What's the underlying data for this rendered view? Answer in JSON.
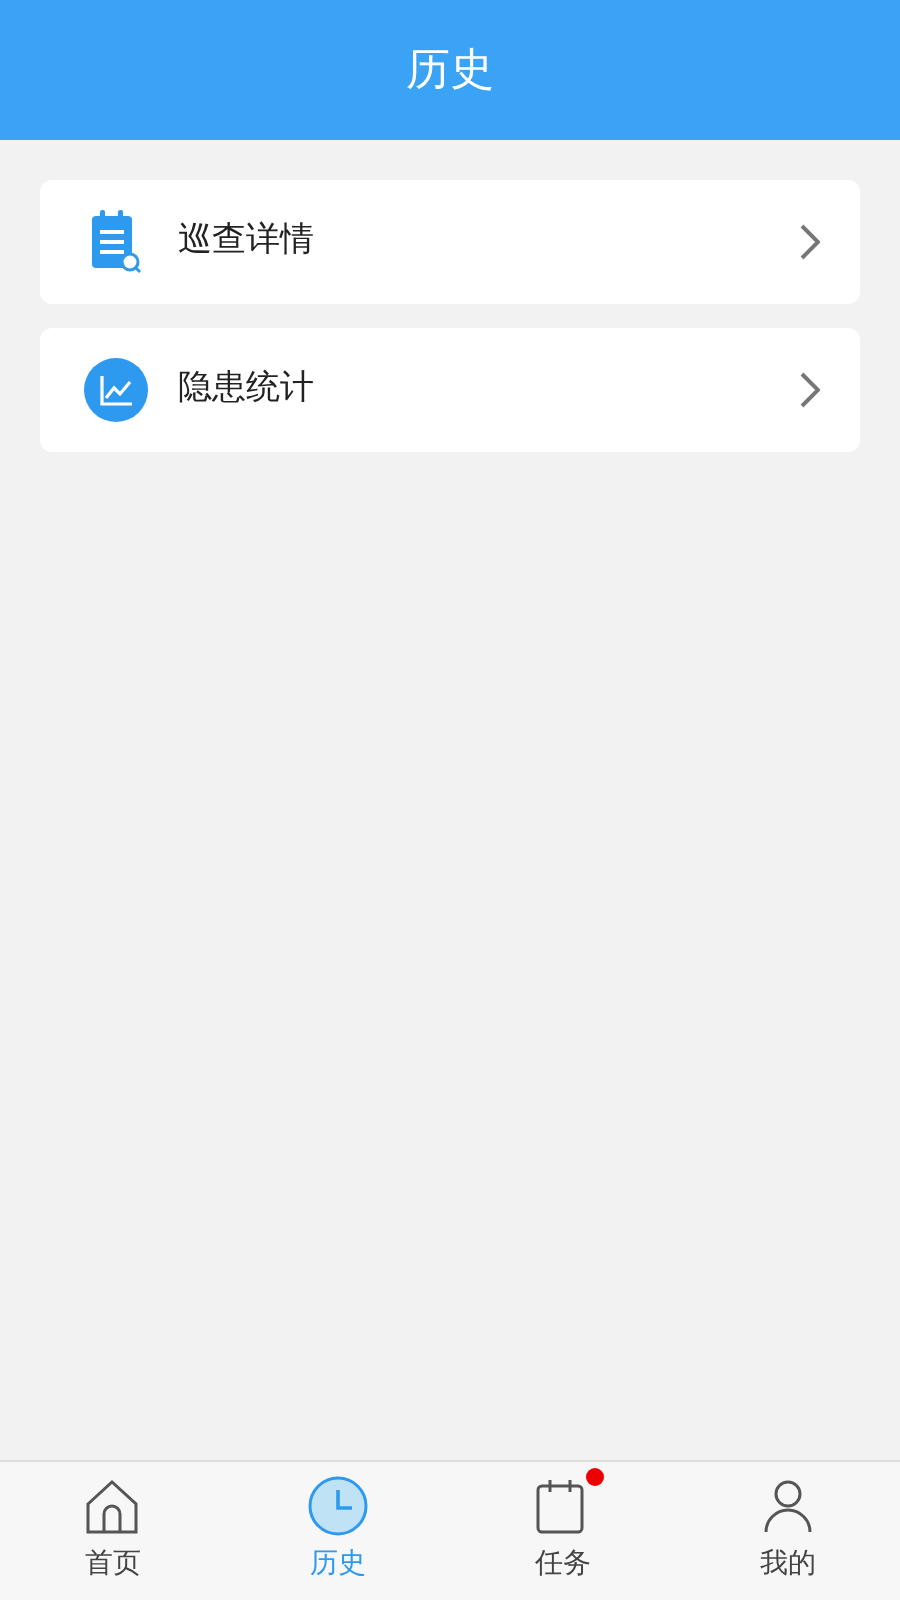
{
  "header": {
    "title": "历史"
  },
  "menu": [
    {
      "kind": "inspection",
      "label": "巡查详情"
    },
    {
      "kind": "stats",
      "label": "隐患统计"
    }
  ],
  "tabs": [
    {
      "kind": "home",
      "label": "首页",
      "selected": false,
      "dot": false
    },
    {
      "kind": "history",
      "label": "历史",
      "selected": true,
      "dot": false
    },
    {
      "kind": "task",
      "label": "任务",
      "selected": false,
      "dot": true
    },
    {
      "kind": "profile",
      "label": "我的",
      "selected": false,
      "dot": false
    }
  ]
}
